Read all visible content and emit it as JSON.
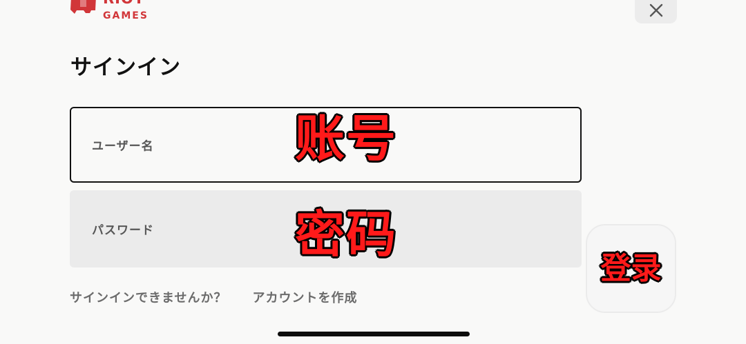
{
  "brand": {
    "name": "RIOT",
    "subtitle": "GAMES",
    "accent_color": "#d13639"
  },
  "header": {
    "close_icon": "close-icon"
  },
  "page": {
    "title": "サインイン"
  },
  "form": {
    "username_label": "ユーザー名",
    "password_label": "パスワード",
    "username_value": "",
    "password_value": ""
  },
  "overlay": {
    "username_text": "账号",
    "password_text": "密码",
    "signin_text": "登录",
    "text_color": "#ff1a1a"
  },
  "footer": {
    "cant_sign_in": "サインインできませんか？",
    "create_account": "アカウントを作成"
  }
}
